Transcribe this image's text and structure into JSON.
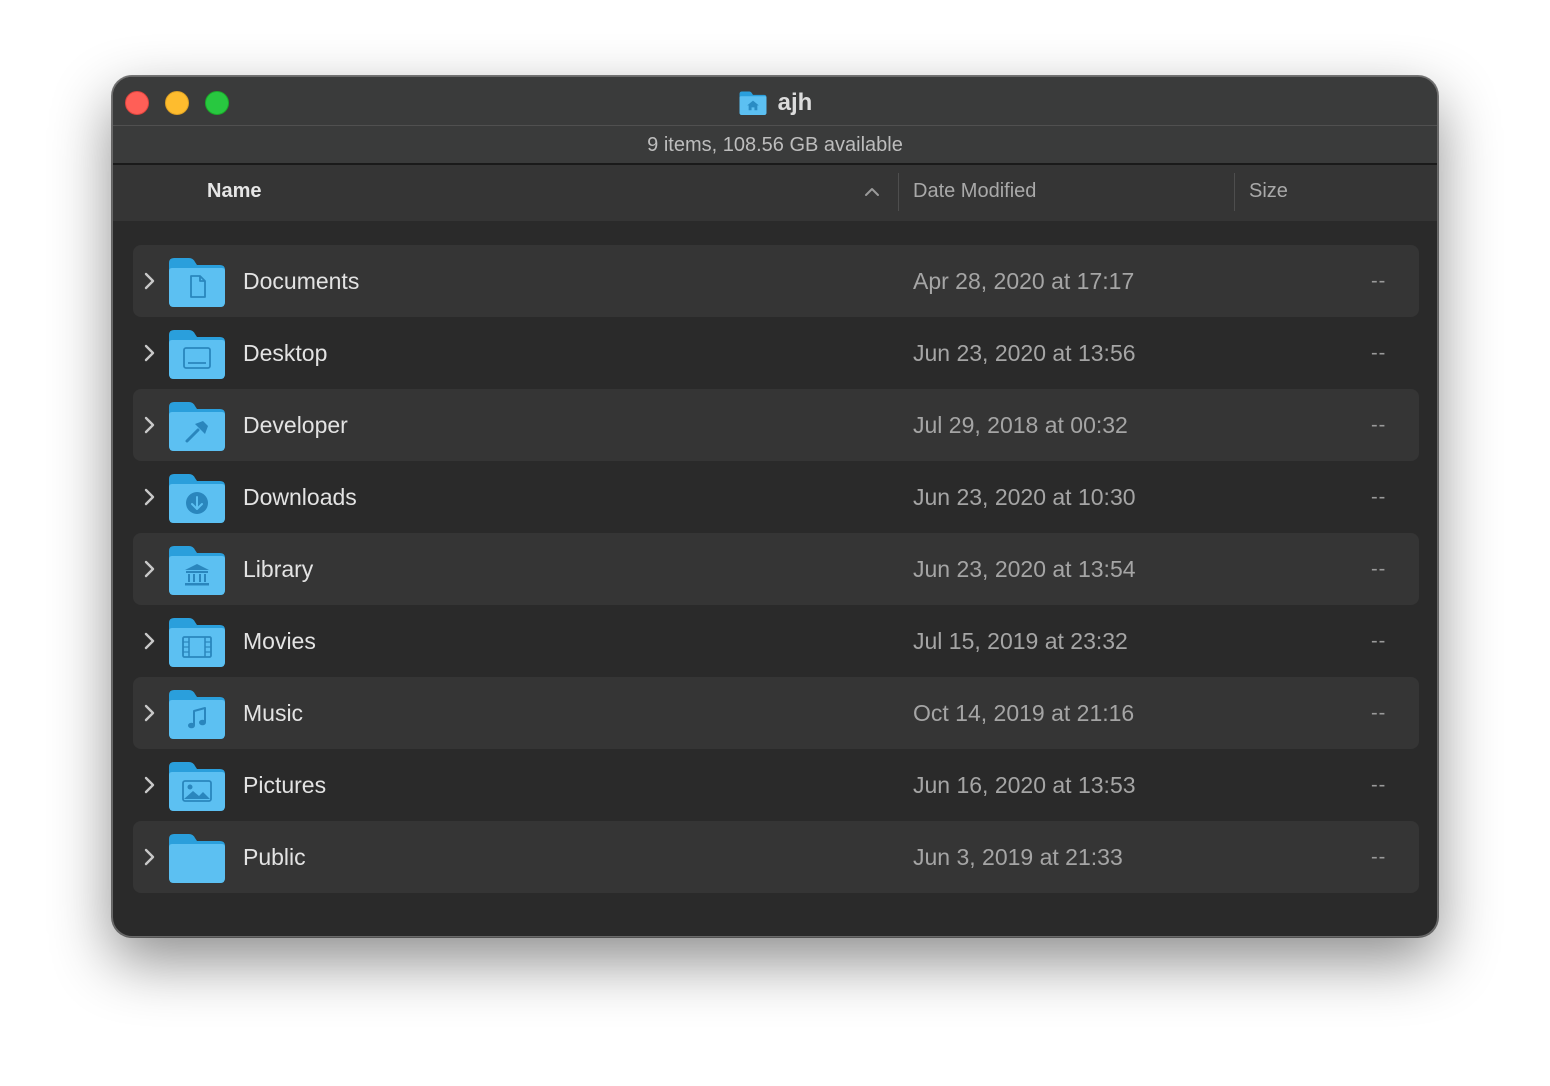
{
  "window": {
    "title": "ajh",
    "title_icon": "home-folder-icon",
    "status": "9 items, 108.56 GB available"
  },
  "columns": {
    "name": "Name",
    "date": "Date Modified",
    "size": "Size",
    "sort_indicator": "chevron-up-icon"
  },
  "colors": {
    "window_bg": "#2a2a2a",
    "titlebar_bg": "#3a3b3b",
    "row_alt_bg": "#353535",
    "folder_blue": "#4fb5ec",
    "close": "#ff5f57",
    "minimize": "#febc2e",
    "zoom": "#28c840"
  },
  "rows": [
    {
      "name": "Documents",
      "date": "Apr 28, 2020 at 17:17",
      "size": "--",
      "icon": "documents-folder-icon"
    },
    {
      "name": "Desktop",
      "date": "Jun 23, 2020 at 13:56",
      "size": "--",
      "icon": "desktop-folder-icon"
    },
    {
      "name": "Developer",
      "date": "Jul 29, 2018 at 00:32",
      "size": "--",
      "icon": "developer-folder-icon"
    },
    {
      "name": "Downloads",
      "date": "Jun 23, 2020 at 10:30",
      "size": "--",
      "icon": "downloads-folder-icon"
    },
    {
      "name": "Library",
      "date": "Jun 23, 2020 at 13:54",
      "size": "--",
      "icon": "library-folder-icon"
    },
    {
      "name": "Movies",
      "date": "Jul 15, 2019 at 23:32",
      "size": "--",
      "icon": "movies-folder-icon"
    },
    {
      "name": "Music",
      "date": "Oct 14, 2019 at 21:16",
      "size": "--",
      "icon": "music-folder-icon"
    },
    {
      "name": "Pictures",
      "date": "Jun 16, 2020 at 13:53",
      "size": "--",
      "icon": "pictures-folder-icon"
    },
    {
      "name": "Public",
      "date": "Jun 3, 2019 at 21:33",
      "size": "--",
      "icon": "public-folder-icon"
    }
  ]
}
